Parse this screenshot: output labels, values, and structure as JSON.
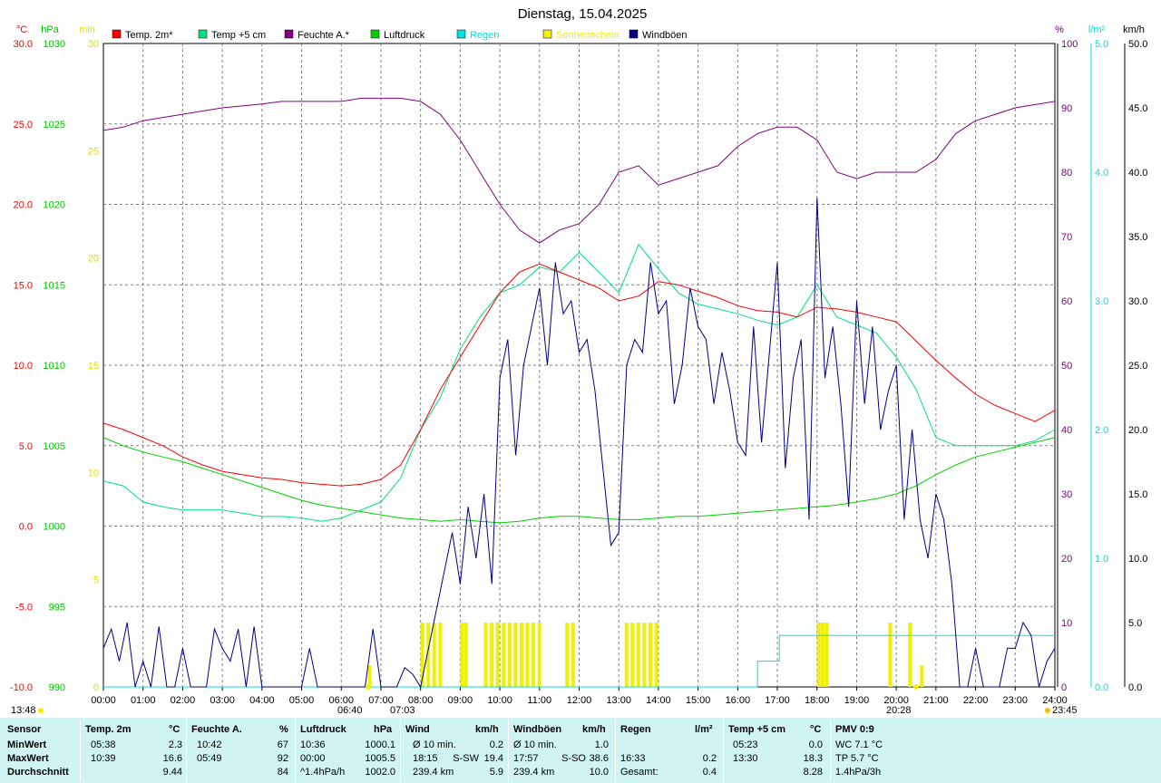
{
  "chart_data": {
    "type": "line",
    "title": "Dienstag, 15.04.2025",
    "x_ticks": [
      "00:00",
      "01:00",
      "02:00",
      "03:00",
      "04:00",
      "05:00",
      "06:00",
      "07:00",
      "08:00",
      "09:00",
      "10:00",
      "11:00",
      "12:00",
      "13:00",
      "14:00",
      "15:00",
      "16:00",
      "17:00",
      "18:00",
      "19:00",
      "20:00",
      "21:00",
      "22:00",
      "23:00",
      "24:00"
    ],
    "xlim": [
      0,
      24
    ],
    "axes": {
      "temp": {
        "unit": "°C",
        "color": "#ff0000",
        "ylim": [
          -10,
          30
        ],
        "ticks": [
          "-10.0",
          "-5.0",
          "0.0",
          "5.0",
          "10.0",
          "15.0",
          "20.0",
          "25.0",
          "30.0"
        ]
      },
      "press": {
        "unit": "hPa",
        "color": "#00c000",
        "ylim": [
          990,
          1030
        ],
        "ticks": [
          "990",
          "995",
          "1000",
          "1005",
          "1010",
          "1015",
          "1020",
          "1025",
          "1030"
        ]
      },
      "sun": {
        "unit": "min",
        "color": "#e0e000",
        "ylim": [
          0,
          30
        ],
        "ticks": [
          "0",
          "5",
          "10",
          "15",
          "20",
          "25",
          "30"
        ]
      },
      "hum": {
        "unit": "%",
        "color": "#800080",
        "ylim": [
          0,
          100
        ],
        "ticks": [
          "0",
          "10",
          "20",
          "30",
          "40",
          "50",
          "60",
          "70",
          "80",
          "90",
          "100"
        ]
      },
      "rain": {
        "unit": "l/m²",
        "color": "#00e0e0",
        "ylim": [
          0,
          5
        ],
        "ticks": [
          "0.0",
          "1.0",
          "2.0",
          "3.0",
          "4.0",
          "5.0"
        ]
      },
      "wind": {
        "unit": "km/h",
        "color": "#000000",
        "ylim": [
          0,
          50
        ],
        "ticks": [
          "0.0",
          "5.0",
          "10.0",
          "15.0",
          "20.0",
          "25.0",
          "30.0",
          "35.0",
          "40.0",
          "45.0",
          "50.0"
        ]
      }
    },
    "legend": [
      {
        "name": "Temp. 2m*",
        "color": "#ff0000"
      },
      {
        "name": "Temp +5 cm",
        "color": "#00e080"
      },
      {
        "name": "Feuchte A.*",
        "color": "#800080"
      },
      {
        "name": "Luftdruck",
        "color": "#00d000"
      },
      {
        "name": "Regen",
        "color": "#00e0e0"
      },
      {
        "name": "Sonnenschein",
        "color": "#f0f000"
      },
      {
        "name": "Windböen",
        "color": "#000080"
      }
    ],
    "series": {
      "temp2m": {
        "axis": "temp",
        "color": "#ff0000",
        "x": [
          0,
          0.5,
          1,
          1.5,
          2,
          2.5,
          3,
          3.5,
          4,
          4.5,
          5,
          5.5,
          6,
          6.5,
          7,
          7.5,
          8,
          8.5,
          9,
          9.5,
          10,
          10.5,
          11,
          11.5,
          12,
          12.5,
          13,
          13.5,
          14,
          14.5,
          15,
          15.5,
          16,
          16.5,
          17,
          17.5,
          18,
          18.5,
          19,
          19.5,
          20,
          20.5,
          21,
          21.5,
          22,
          22.5,
          23,
          23.5,
          24
        ],
        "y": [
          6.4,
          6.0,
          5.5,
          5.0,
          4.3,
          3.8,
          3.4,
          3.2,
          3.0,
          2.9,
          2.7,
          2.6,
          2.5,
          2.6,
          2.9,
          3.8,
          6.0,
          8.5,
          10.5,
          12.5,
          14.5,
          15.8,
          16.3,
          15.8,
          15.3,
          14.8,
          14.0,
          14.3,
          15.2,
          15.0,
          14.6,
          14.2,
          13.7,
          13.4,
          13.3,
          13.0,
          13.6,
          13.5,
          13.3,
          13.0,
          12.7,
          11.5,
          10.3,
          9.2,
          8.2,
          7.5,
          7.0,
          6.5,
          7.2
        ]
      },
      "temp5cm": {
        "axis": "temp",
        "color": "#00e080",
        "x": [
          0,
          0.5,
          1,
          1.5,
          2,
          2.5,
          3,
          3.5,
          4,
          4.5,
          5,
          5.5,
          6,
          6.5,
          7,
          7.5,
          8,
          8.5,
          9,
          9.5,
          10,
          10.5,
          11,
          11.5,
          12,
          12.5,
          13,
          13.5,
          14,
          14.5,
          15,
          15.5,
          16,
          16.5,
          17,
          17.5,
          18,
          18.5,
          19,
          19.5,
          20,
          20.5,
          21,
          21.5,
          22,
          22.5,
          23,
          23.5,
          24
        ],
        "y": [
          2.8,
          2.5,
          1.5,
          1.2,
          1.0,
          1.0,
          1.0,
          0.8,
          0.6,
          0.6,
          0.5,
          0.3,
          0.5,
          1.0,
          1.5,
          3.0,
          6.0,
          8.0,
          11.0,
          13.0,
          14.5,
          15.0,
          16.1,
          15.8,
          17.0,
          15.8,
          14.5,
          17.5,
          16.0,
          14.5,
          13.8,
          13.5,
          13.2,
          12.8,
          12.5,
          13.0,
          15.0,
          13.0,
          12.5,
          12.0,
          10.5,
          8.5,
          5.5,
          5.0,
          5.0,
          5.0,
          5.0,
          5.3,
          6.0
        ]
      },
      "humidity": {
        "axis": "hum",
        "color": "#800080",
        "x": [
          0,
          0.5,
          1,
          1.5,
          2,
          2.5,
          3,
          3.5,
          4,
          4.5,
          5,
          5.5,
          6,
          6.5,
          7,
          7.5,
          8,
          8.5,
          9,
          9.5,
          10,
          10.5,
          11,
          11.5,
          12,
          12.5,
          13,
          13.5,
          14,
          14.5,
          15,
          15.5,
          16,
          16.5,
          17,
          17.5,
          18,
          18.5,
          19,
          19.5,
          20,
          20.5,
          21,
          21.5,
          22,
          22.5,
          23,
          23.5,
          24
        ],
        "y": [
          86.5,
          87,
          88,
          88.5,
          89,
          89.5,
          90,
          90.3,
          90.6,
          91,
          91,
          91,
          91,
          91.5,
          91.5,
          91.5,
          91,
          89,
          85,
          80,
          75,
          71,
          69,
          71,
          72,
          75,
          80,
          81,
          78,
          79,
          80,
          81,
          84,
          86,
          87,
          87,
          85,
          80,
          79,
          80,
          80,
          80,
          82,
          86,
          88,
          89,
          90,
          90.5,
          91
        ]
      },
      "pressure": {
        "axis": "press",
        "color": "#00d000",
        "x": [
          0,
          0.5,
          1,
          1.5,
          2,
          2.5,
          3,
          3.5,
          4,
          4.5,
          5,
          5.5,
          6,
          6.5,
          7,
          7.5,
          8,
          8.5,
          9,
          9.5,
          10,
          10.5,
          11,
          11.5,
          12,
          12.5,
          13,
          13.5,
          14,
          14.5,
          15,
          15.5,
          16,
          16.5,
          17,
          17.5,
          18,
          18.5,
          19,
          19.5,
          20,
          20.5,
          21,
          21.5,
          22,
          22.5,
          23,
          23.5,
          24
        ],
        "y": [
          1005.5,
          1005.0,
          1004.6,
          1004.3,
          1004.0,
          1003.6,
          1003.2,
          1002.8,
          1002.4,
          1002.0,
          1001.6,
          1001.3,
          1001.1,
          1000.9,
          1000.7,
          1000.5,
          1000.4,
          1000.3,
          1000.4,
          1000.3,
          1000.2,
          1000.3,
          1000.5,
          1000.6,
          1000.6,
          1000.5,
          1000.4,
          1000.4,
          1000.5,
          1000.6,
          1000.6,
          1000.7,
          1000.8,
          1000.9,
          1001.0,
          1001.1,
          1001.2,
          1001.3,
          1001.5,
          1001.7,
          1002.0,
          1002.5,
          1003.2,
          1003.8,
          1004.3,
          1004.6,
          1004.9,
          1005.2,
          1005.5
        ]
      },
      "gusts": {
        "axis": "wind",
        "color": "#000080",
        "x": [
          0,
          0.2,
          0.4,
          0.6,
          0.8,
          1,
          1.2,
          1.4,
          1.6,
          1.8,
          2,
          2.2,
          2.4,
          2.6,
          2.8,
          3,
          3.2,
          3.4,
          3.6,
          3.8,
          4,
          4.2,
          4.4,
          4.6,
          4.8,
          5,
          5.2,
          5.4,
          5.6,
          5.8,
          6,
          6.2,
          6.4,
          6.6,
          6.8,
          7,
          7.2,
          7.4,
          7.6,
          7.8,
          8,
          8.2,
          8.4,
          8.6,
          8.8,
          9,
          9.2,
          9.4,
          9.6,
          9.8,
          10,
          10.2,
          10.4,
          10.6,
          10.8,
          11,
          11.2,
          11.4,
          11.6,
          11.8,
          12,
          12.2,
          12.4,
          12.6,
          12.8,
          13,
          13.2,
          13.4,
          13.6,
          13.8,
          14,
          14.2,
          14.4,
          14.6,
          14.8,
          15,
          15.2,
          15.4,
          15.6,
          15.8,
          16,
          16.2,
          16.4,
          16.6,
          16.8,
          17,
          17.2,
          17.4,
          17.6,
          17.8,
          18,
          18.2,
          18.4,
          18.6,
          18.8,
          19,
          19.2,
          19.4,
          19.6,
          19.8,
          20,
          20.2,
          20.4,
          20.6,
          20.8,
          21,
          21.2,
          21.4,
          21.6,
          21.8,
          22,
          22.2,
          22.4,
          22.6,
          22.8,
          23,
          23.2,
          23.4,
          23.6,
          23.8,
          24
        ],
        "y": [
          3,
          4.5,
          2,
          5,
          0,
          2,
          0,
          4.7,
          0,
          0,
          3,
          0,
          0,
          0,
          4.5,
          3,
          2,
          4.5,
          0,
          4.7,
          0,
          0,
          0,
          0,
          0,
          0,
          3,
          0,
          0,
          0,
          0,
          0,
          0,
          0,
          4.5,
          0,
          0,
          0,
          1.5,
          1,
          0,
          3,
          6,
          9,
          12,
          8,
          14,
          10,
          15,
          8,
          24,
          27,
          18,
          25,
          28,
          31,
          25,
          33,
          29,
          30,
          26,
          27,
          23,
          17,
          11,
          12,
          25,
          27,
          26,
          33,
          29,
          30,
          22,
          25,
          31,
          28,
          27,
          22,
          26,
          23,
          19,
          18,
          28,
          19,
          26,
          33,
          17,
          24,
          27,
          13,
          38,
          24,
          28,
          22,
          14,
          30,
          22,
          28,
          20,
          23,
          25,
          13,
          20,
          13,
          10,
          15,
          13,
          8,
          0,
          0,
          3,
          0,
          0,
          0,
          3,
          3,
          5,
          4,
          0,
          2,
          3,
          6,
          0
        ]
      },
      "rain": {
        "axis": "rain",
        "color": "#00e0e0",
        "x": [
          0,
          16.5,
          16.5,
          17.05,
          17.05,
          24
        ],
        "y": [
          0,
          0,
          0.2,
          0.2,
          0.4,
          0.4
        ]
      }
    },
    "sunshine_bars": {
      "axis": "sun",
      "color": "#f0f000",
      "x": [
        6.67,
        8.0,
        8.15,
        8.3,
        8.45,
        9.0,
        9.1,
        9.6,
        9.75,
        9.9,
        10.05,
        10.2,
        10.35,
        10.5,
        10.65,
        10.8,
        10.95,
        11.65,
        11.8,
        13.15,
        13.3,
        13.45,
        13.6,
        13.75,
        13.9,
        18.0,
        18.1,
        18.2,
        19.8,
        20.3,
        20.6
      ],
      "y": [
        1,
        3,
        3,
        3,
        3,
        3,
        3,
        3,
        3,
        3,
        3,
        3,
        3,
        3,
        3,
        3,
        3,
        3,
        3,
        3,
        3,
        3,
        3,
        3,
        3,
        3,
        3,
        3,
        3,
        3,
        1
      ]
    },
    "sun_marks": {
      "sunrise": "06:40",
      "sunrise_2": "07:03",
      "sunset": "20:28",
      "transit": "13:48",
      "moonset": "23:45"
    }
  },
  "stats": {
    "headers": [
      "Sensor",
      "Temp. 2m",
      "°C",
      "Feuchte A.",
      "%",
      "Luftdruck",
      "hPa",
      "Wind",
      "km/h",
      "Windböen",
      "km/h",
      "Regen",
      "l/m²",
      "Temp +5 cm",
      "°C",
      "PMV 0:9"
    ],
    "rows": {
      "labels": [
        "MinWert",
        "MaxWert",
        "Durchschnitt"
      ],
      "temp": [
        [
          "05:38",
          "2.3"
        ],
        [
          "10:39",
          "16.6"
        ],
        [
          "",
          "9.44"
        ]
      ],
      "hum": [
        [
          "10:42",
          "67"
        ],
        [
          "05:49",
          "92"
        ],
        [
          "",
          "84"
        ]
      ],
      "press": [
        [
          "10:36",
          "1000.1"
        ],
        [
          "00:00",
          "1005.5"
        ],
        [
          "^1.4hPa/h",
          "1002.0"
        ]
      ],
      "wind": [
        [
          "Ø 10 min.",
          "",
          "0.2"
        ],
        [
          "18:15",
          "S-SW",
          "19.4"
        ],
        [
          "239.4 km",
          "",
          "5.9"
        ]
      ],
      "gust": [
        [
          "Ø 10 min.",
          "",
          "1.0"
        ],
        [
          "17:57",
          "S-SO",
          "38.6"
        ],
        [
          "239.4 km",
          "",
          "10.0"
        ]
      ],
      "rain": [
        [
          "",
          ""
        ],
        [
          "16:33",
          "0.2"
        ],
        [
          "Gesamt:",
          "0.4"
        ]
      ],
      "t5": [
        [
          "05:23",
          "0.0"
        ],
        [
          "13:30",
          "18.3"
        ],
        [
          "",
          "8.28"
        ]
      ],
      "pmv": [
        "WC 7.1 °C",
        "TP 5.7 °C",
        "1.4hPa/3h"
      ]
    }
  }
}
